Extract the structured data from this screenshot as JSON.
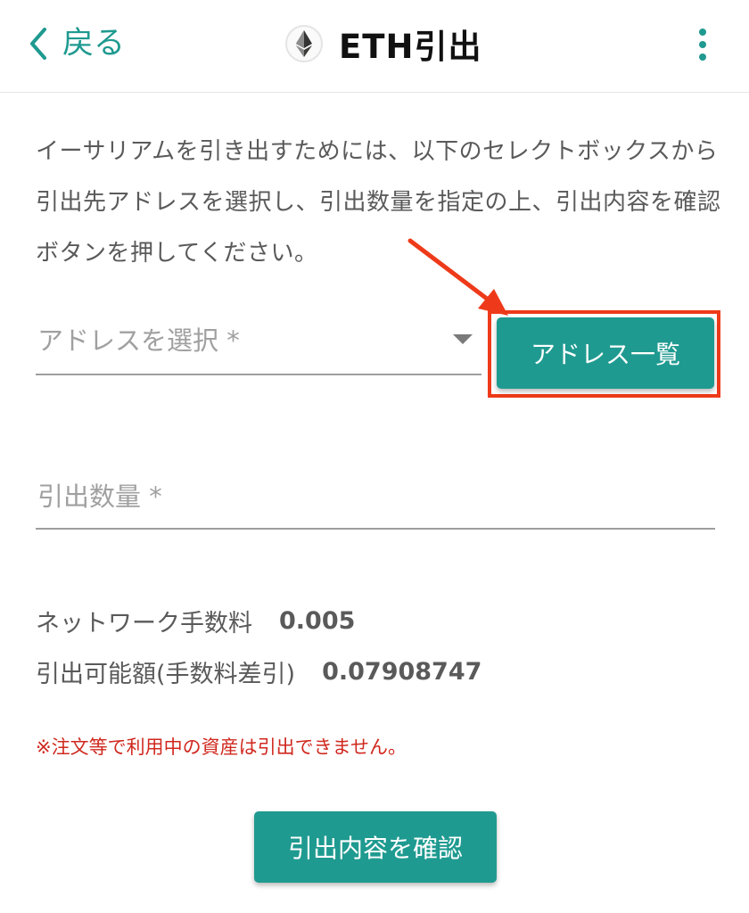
{
  "header": {
    "back_label": "戻る",
    "title": "ETH引出",
    "coin_icon": "ethereum-icon",
    "accent_color": "#1f9a90"
  },
  "form": {
    "description": "イーサリアムを引き出すためには、以下のセレクトボックスから引出先アドレスを選択し、引出数量を指定の上、引出内容を確認ボタンを押してください。",
    "address_placeholder": "アドレスを選択 *",
    "address_list_label": "アドレス一覧",
    "amount_placeholder": "引出数量 *",
    "network_fee_label": "ネットワーク手数料",
    "network_fee_value": "0.005",
    "available_label": "引出可能額(手数料差引)",
    "available_value": "0.07908747",
    "notice": "※注文等で利用中の資産は引出できません。",
    "confirm_label": "引出内容を確認"
  },
  "annotation": {
    "highlight_color": "#ee3a1a"
  }
}
